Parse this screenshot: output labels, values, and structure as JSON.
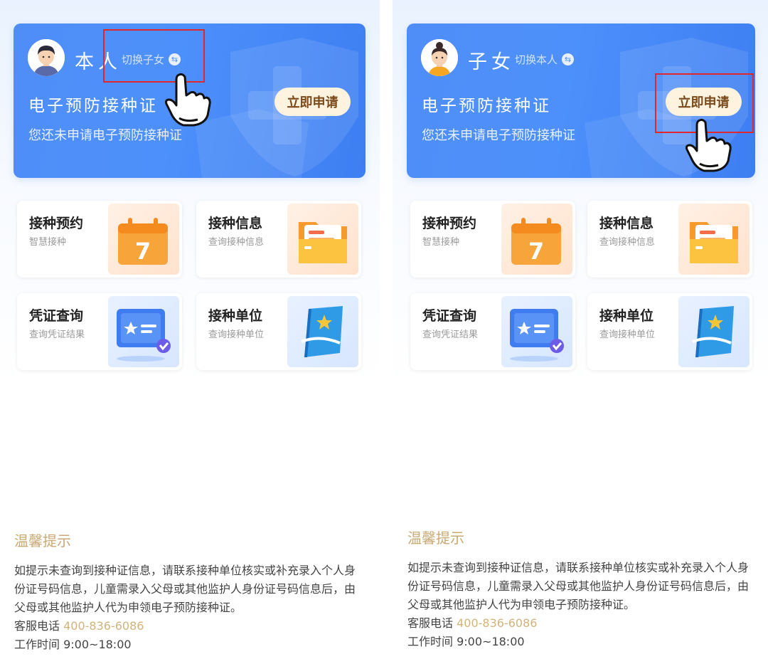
{
  "panels": [
    {
      "identity": "本人",
      "switch_label": "切换子女",
      "cert_title": "电子预防接种证",
      "cert_subtitle": "您还未申请电子预防接种证",
      "apply_button": "立即申请",
      "avatar": "boy-avatar-icon"
    },
    {
      "identity": "子女",
      "switch_label": "切换本人",
      "cert_title": "电子预防接种证",
      "cert_subtitle": "您还未申请电子预防接种证",
      "apply_button": "立即申请",
      "avatar": "girl-avatar-icon"
    }
  ],
  "tiles": [
    {
      "title": "接种预约",
      "subtitle": "智慧接种",
      "icon": "calendar-icon",
      "calendar_day": "7"
    },
    {
      "title": "接种信息",
      "subtitle": "查询接种信息",
      "icon": "folder-icon"
    },
    {
      "title": "凭证查询",
      "subtitle": "查询凭证结果",
      "icon": "certificate-card-icon"
    },
    {
      "title": "接种单位",
      "subtitle": "查询接种单位",
      "icon": "star-book-icon"
    }
  ],
  "tips": {
    "title": "温馨提示",
    "body": "如提示未查询到接种证信息，请联系接种单位核实或补充录入个人身份证号码信息，儿童需录入父母或其他监护人身份证号码信息后，由父母或其他监护人代为申领电子预防接种证。",
    "phone_label": "客服电话",
    "phone": "400-836-6086",
    "hours_label": "工作时间",
    "hours": "9:00~18:00"
  },
  "colors": {
    "hero_blue": "#4d8ef7",
    "apply_bg": "#fdf3de",
    "highlight_red": "#e0262e",
    "tips_gold": "#c9a974"
  }
}
